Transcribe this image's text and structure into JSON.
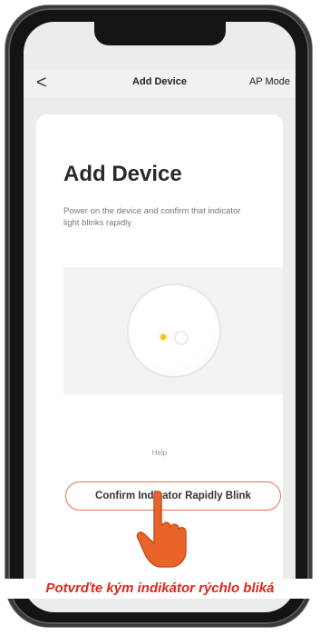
{
  "nav": {
    "back_icon": "chevron-left-icon",
    "back_glyph": "<",
    "title": "Add Device",
    "mode": "AP Mode"
  },
  "card": {
    "title": "Add Device",
    "description": "Power on the device and confirm that indicator light blinks rapidly",
    "help_link": "Help",
    "confirm_button": "Confirm Indicator Rapidly Blink"
  },
  "caption": "Potvrďte kým indikátor rýchlo bliká",
  "colors": {
    "accent": "#e8704a",
    "caption": "#e0271c",
    "hand": "#e8642a",
    "led": "#f0c419"
  },
  "icons": [
    "chevron-left-icon",
    "pointing-hand-icon"
  ]
}
